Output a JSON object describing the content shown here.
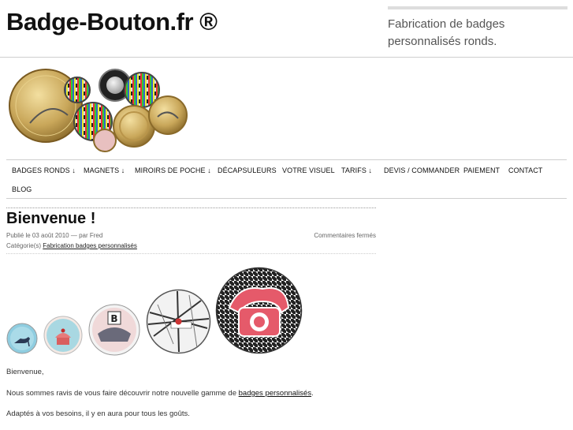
{
  "header": {
    "site_title": "Badge-Bouton.fr ®",
    "tagline": "Fabrication de badges personnalisés ronds."
  },
  "nav": {
    "items": [
      {
        "label": "BADGES RONDS ↓"
      },
      {
        "label": "MAGNETS ↓"
      },
      {
        "label": "MIROIRS DE POCHE ↓"
      },
      {
        "label": "DÉCAPSULEURS"
      },
      {
        "label": "VOTRE VISUEL"
      },
      {
        "label": "TARIFS ↓"
      },
      {
        "label": "DEVIS / COMMANDER"
      },
      {
        "label": "PAIEMENT"
      },
      {
        "label": "CONTACT"
      },
      {
        "label": "BLOG"
      }
    ]
  },
  "post": {
    "title": "Bienvenue !",
    "meta": "Publié le 03 août 2010 — par Fred",
    "comments": "Commentaires fermés",
    "category_prefix": "Catégorie(s)",
    "category_link": "Fabrication badges personnalisés",
    "greeting": "Bienvenue,",
    "para1_prefix": "Nous sommes ravis de vous faire découvrir notre nouvelle gamme de",
    "para1_link": "badges personnalisés",
    "para1_suffix": ".",
    "para2": "Adaptés à vos besoins, il y en aura pour tous les goûts."
  },
  "icons": {
    "hero": "badge-collection-image",
    "badges": [
      "shoe-badge",
      "cupcake-badge",
      "letter-b-badge",
      "bastille-map-badge",
      "telephone-badge"
    ]
  }
}
